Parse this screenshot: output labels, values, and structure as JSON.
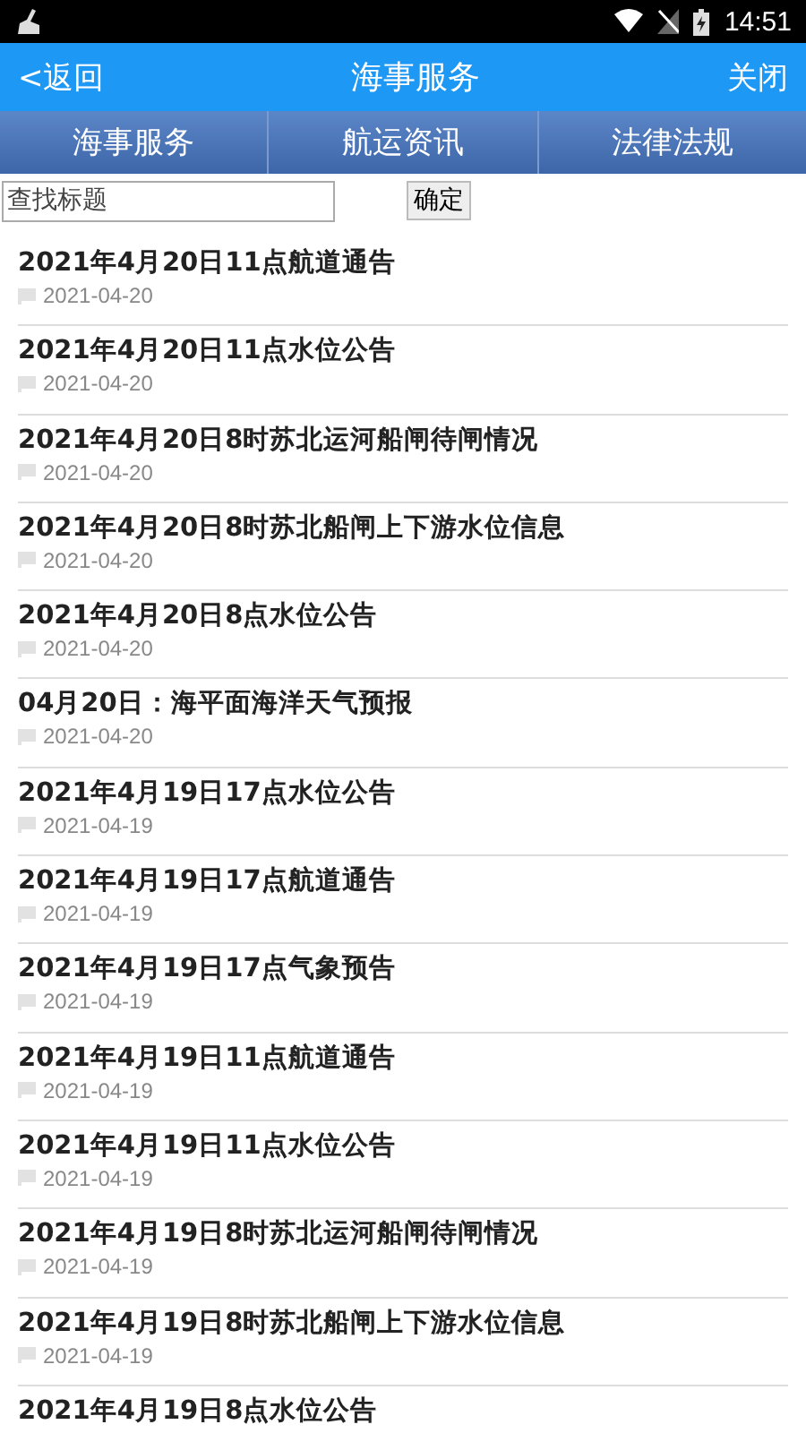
{
  "status_bar": {
    "time": "14:51"
  },
  "header": {
    "back": "<返回",
    "title": "海事服务",
    "close": "关闭"
  },
  "tabs": [
    {
      "label": "海事服务"
    },
    {
      "label": "航运资讯"
    },
    {
      "label": "法律法规"
    }
  ],
  "search": {
    "placeholder": "查找标题",
    "button": "确定"
  },
  "items": [
    {
      "title": "2021年4月20日11点航道通告",
      "date": "2021-04-20"
    },
    {
      "title": "2021年4月20日11点水位公告",
      "date": "2021-04-20"
    },
    {
      "title": "2021年4月20日8时苏北运河船闸待闸情况",
      "date": "2021-04-20"
    },
    {
      "title": "2021年4月20日8时苏北船闸上下游水位信息",
      "date": "2021-04-20"
    },
    {
      "title": "2021年4月20日8点水位公告",
      "date": "2021-04-20"
    },
    {
      "title": "04月20日：海平面海洋天气预报",
      "date": "2021-04-20"
    },
    {
      "title": "2021年4月19日17点水位公告",
      "date": "2021-04-19"
    },
    {
      "title": "2021年4月19日17点航道通告",
      "date": "2021-04-19"
    },
    {
      "title": "2021年4月19日17点气象预告",
      "date": "2021-04-19"
    },
    {
      "title": "2021年4月19日11点航道通告",
      "date": "2021-04-19"
    },
    {
      "title": "2021年4月19日11点水位公告",
      "date": "2021-04-19"
    },
    {
      "title": "2021年4月19日8时苏北运河船闸待闸情况",
      "date": "2021-04-19"
    },
    {
      "title": "2021年4月19日8时苏北船闸上下游水位信息",
      "date": "2021-04-19"
    },
    {
      "title": "2021年4月19日8点水位公告"
    }
  ]
}
